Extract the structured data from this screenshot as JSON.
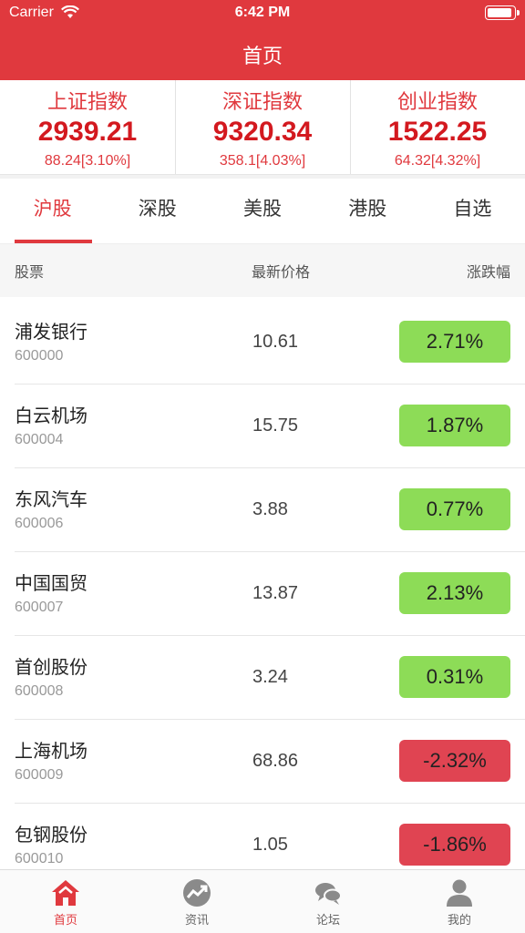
{
  "status_bar": {
    "carrier": "Carrier",
    "time": "6:42 PM"
  },
  "nav": {
    "title": "首页"
  },
  "indices": [
    {
      "name": "上证指数",
      "value": "2939.21",
      "change": "88.24[3.10%]"
    },
    {
      "name": "深证指数",
      "value": "9320.34",
      "change": "358.1[4.03%]"
    },
    {
      "name": "创业指数",
      "value": "1522.25",
      "change": "64.32[4.32%]"
    }
  ],
  "tabs": [
    {
      "label": "沪股",
      "active": true
    },
    {
      "label": "深股",
      "active": false
    },
    {
      "label": "美股",
      "active": false
    },
    {
      "label": "港股",
      "active": false
    },
    {
      "label": "自选",
      "active": false
    }
  ],
  "columns": {
    "stock": "股票",
    "price": "最新价格",
    "change": "涨跌幅"
  },
  "colors": {
    "up": "#8ddc57",
    "down": "#e04452",
    "accent": "#e0393e"
  },
  "stocks": [
    {
      "name": "浦发银行",
      "code": "600000",
      "price": "10.61",
      "change": "2.71%",
      "direction": "up"
    },
    {
      "name": "白云机场",
      "code": "600004",
      "price": "15.75",
      "change": "1.87%",
      "direction": "up"
    },
    {
      "name": "东风汽车",
      "code": "600006",
      "price": "3.88",
      "change": "0.77%",
      "direction": "up"
    },
    {
      "name": "中国国贸",
      "code": "600007",
      "price": "13.87",
      "change": "2.13%",
      "direction": "up"
    },
    {
      "name": "首创股份",
      "code": "600008",
      "price": "3.24",
      "change": "0.31%",
      "direction": "up"
    },
    {
      "name": "上海机场",
      "code": "600009",
      "price": "68.86",
      "change": "-2.32%",
      "direction": "down"
    },
    {
      "name": "包钢股份",
      "code": "600010",
      "price": "1.05",
      "change": "-1.86%",
      "direction": "down"
    }
  ],
  "tabbar": [
    {
      "label": "首页",
      "icon": "home-icon",
      "active": true
    },
    {
      "label": "资讯",
      "icon": "trend-icon",
      "active": false
    },
    {
      "label": "论坛",
      "icon": "chat-icon",
      "active": false
    },
    {
      "label": "我的",
      "icon": "user-icon",
      "active": false
    }
  ]
}
